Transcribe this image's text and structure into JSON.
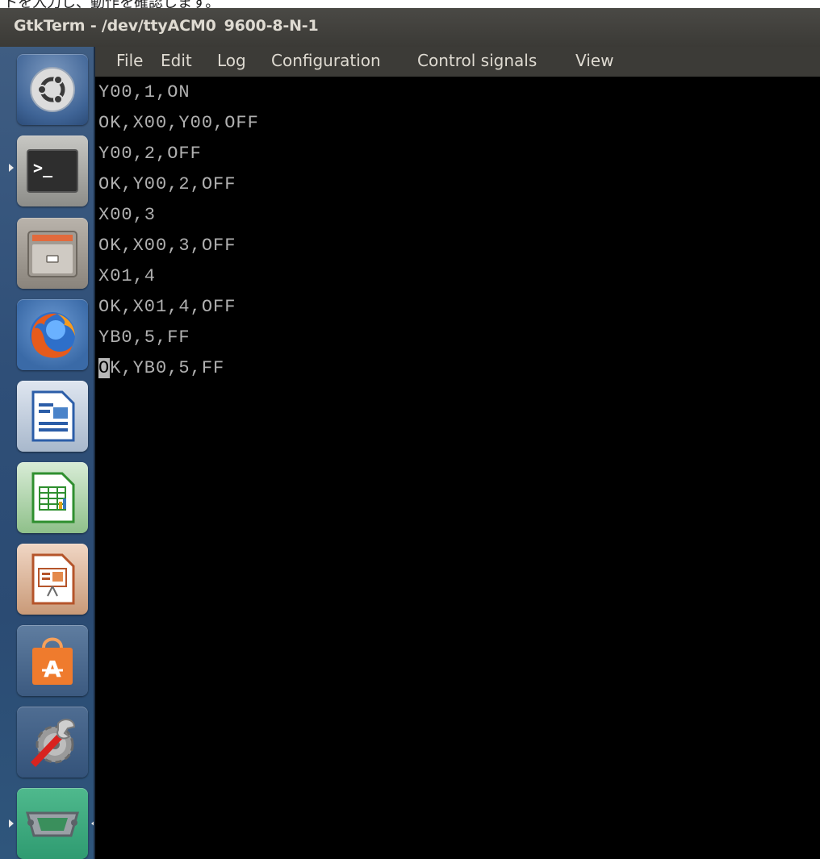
{
  "caption": "トを入力し、動作を確認します。",
  "window": {
    "title": "GtkTerm - /dev/ttyACM0",
    "params": "9600-8-N-1"
  },
  "menu": {
    "items": [
      "File",
      "Edit",
      "Log",
      "Configuration",
      "Control signals",
      "View"
    ]
  },
  "terminal": {
    "lines": [
      "Y00,1,ON",
      "OK,X00,Y00,OFF",
      "Y00,2,OFF",
      "OK,Y00,2,OFF",
      "X00,3",
      "OK,X00,3,OFF",
      "X01,4",
      "OK,X01,4,OFF",
      "YB0,5,FF",
      "OK,YB0,5,FF"
    ],
    "cursor_char": "O",
    "cursor_rest": "K,YB0,5,FF"
  },
  "launcher": {
    "icons": [
      "ubuntu-dash-icon",
      "terminal-icon",
      "file-manager-icon",
      "firefox-icon",
      "writer-icon",
      "calc-icon",
      "impress-icon",
      "software-center-icon",
      "system-settings-icon",
      "serial-port-icon"
    ]
  },
  "colors": {
    "terminal_bg": "#000000",
    "terminal_fg": "#b0b0b0",
    "titlebar": "#3c3b37",
    "launcher": "#2f4f78"
  }
}
